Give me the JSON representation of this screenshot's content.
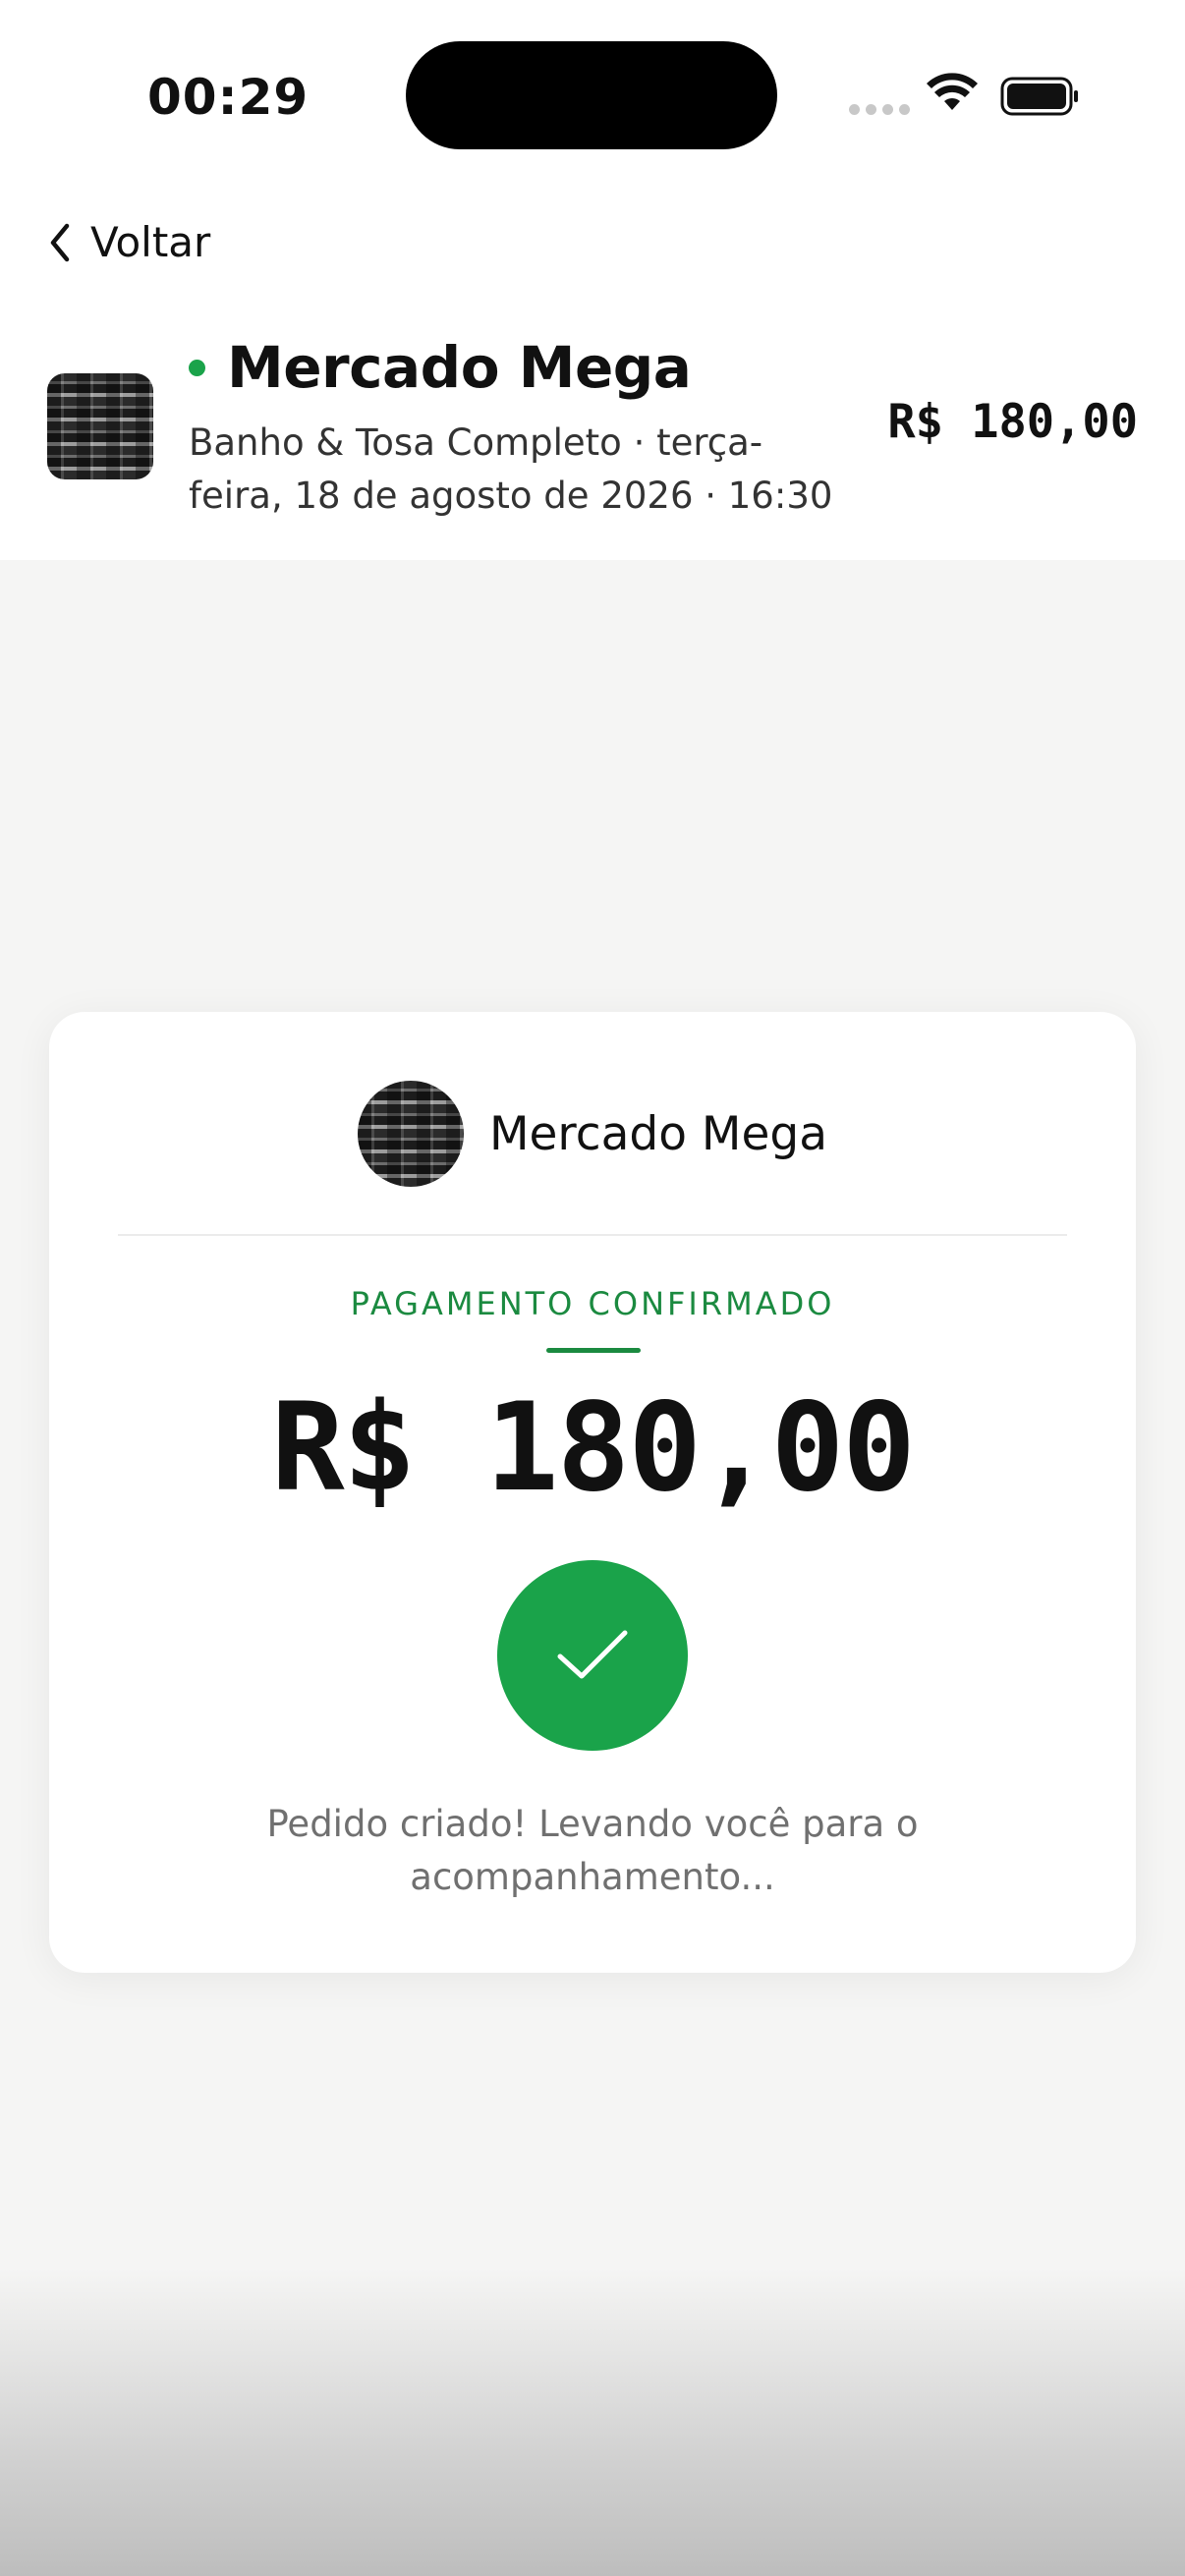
{
  "status_bar": {
    "time": "00:29"
  },
  "nav": {
    "back_label": "Voltar"
  },
  "header": {
    "merchant_name": "Mercado Mega",
    "service_details": "Banho & Tosa Completo · terça-feira, 18 de agosto de 2026 · 16:30",
    "price": "R$ 180,00",
    "status_dot_color": "#1aa34a"
  },
  "card": {
    "merchant_name": "Mercado Mega",
    "status_label": "PAGAMENTO CONFIRMADO",
    "amount": "R$ 180,00",
    "message": "Pedido criado! Levando você para o acompanhamento...",
    "accent_color": "#1b8a40",
    "check_color": "#1aa34a"
  }
}
